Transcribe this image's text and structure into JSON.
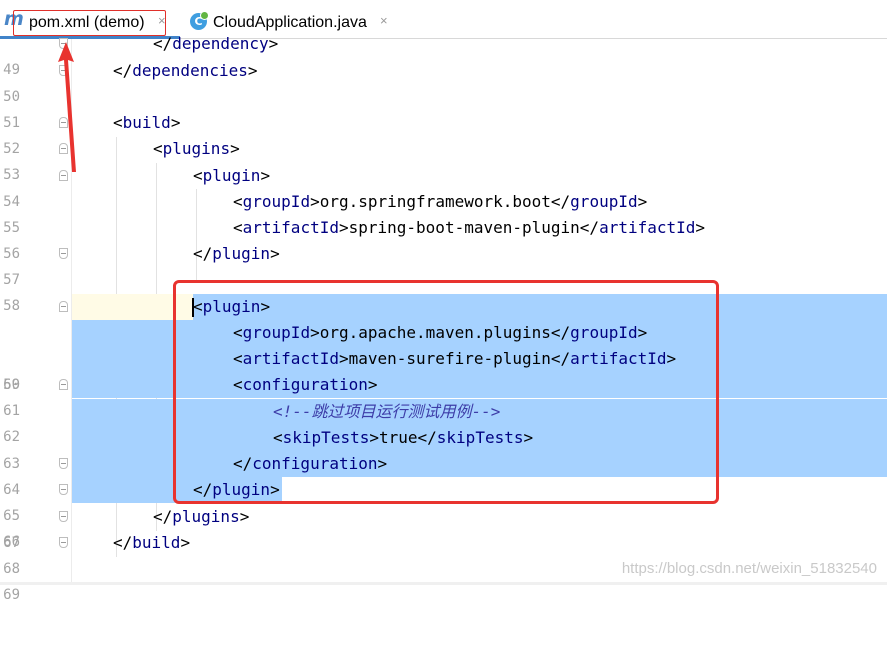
{
  "tabs": [
    {
      "label": "pom.xml (demo)",
      "icon": "maven-icon",
      "active": true
    },
    {
      "label": "CloudApplication.java",
      "icon": "java-class-icon",
      "active": false
    }
  ],
  "tab_close_glyph": "×",
  "line_numbers": [
    "49",
    "50",
    "51",
    "52",
    "53",
    "54",
    "55",
    "56",
    "57",
    "58",
    "59",
    "60",
    "61",
    "62",
    "63",
    "64",
    "65",
    "66",
    "67",
    "68",
    "69"
  ],
  "code": {
    "l49_tag": "dependency",
    "l50_tag": "dependencies",
    "l52_tag": "build",
    "l53_tag": "plugins",
    "l54_tag": "plugin",
    "l55_tag": "groupId",
    "l55_text": "org.springframework.boot",
    "l56_tag": "artifactId",
    "l56_text": "spring-boot-maven-plugin",
    "l57_tag": "plugin",
    "l59_tag": "plugin",
    "l60_tag": "groupId",
    "l60_text": "org.apache.maven.plugins",
    "l61_tag": "artifactId",
    "l61_text": "maven-surefire-plugin",
    "l62_tag": "configuration",
    "l63_comment": "<!--跳过项目运行测试用例-->",
    "l64_tag": "skipTests",
    "l64_text": "true",
    "l65_tag": "configuration",
    "l66_tag": "plugin",
    "l67_tag": "plugins",
    "l68_tag": "build"
  },
  "watermark": "https://blog.csdn.net/weixin_51832540",
  "colors": {
    "selection": "#a6d2ff",
    "tag": "#000080",
    "annotation_red": "#e8332f",
    "comment": "#3d3da8"
  }
}
